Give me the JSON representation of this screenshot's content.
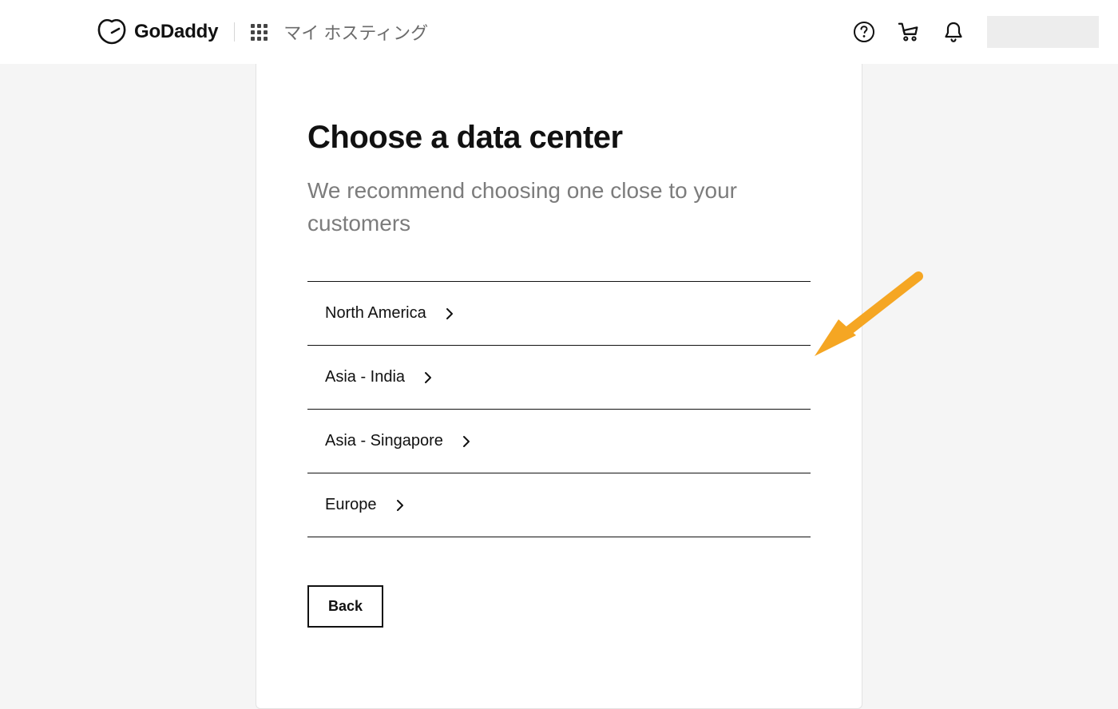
{
  "header": {
    "brand": "GoDaddy",
    "breadcrumb": "マイ ホスティング"
  },
  "card": {
    "title": "Choose a data center",
    "subtitle": "We recommend choosing one close to your customers",
    "back_label": "Back",
    "regions": [
      {
        "label": "North America"
      },
      {
        "label": "Asia - India"
      },
      {
        "label": "Asia - Singapore"
      },
      {
        "label": "Europe"
      }
    ]
  },
  "colors": {
    "annotation_arrow": "#f5a623"
  }
}
